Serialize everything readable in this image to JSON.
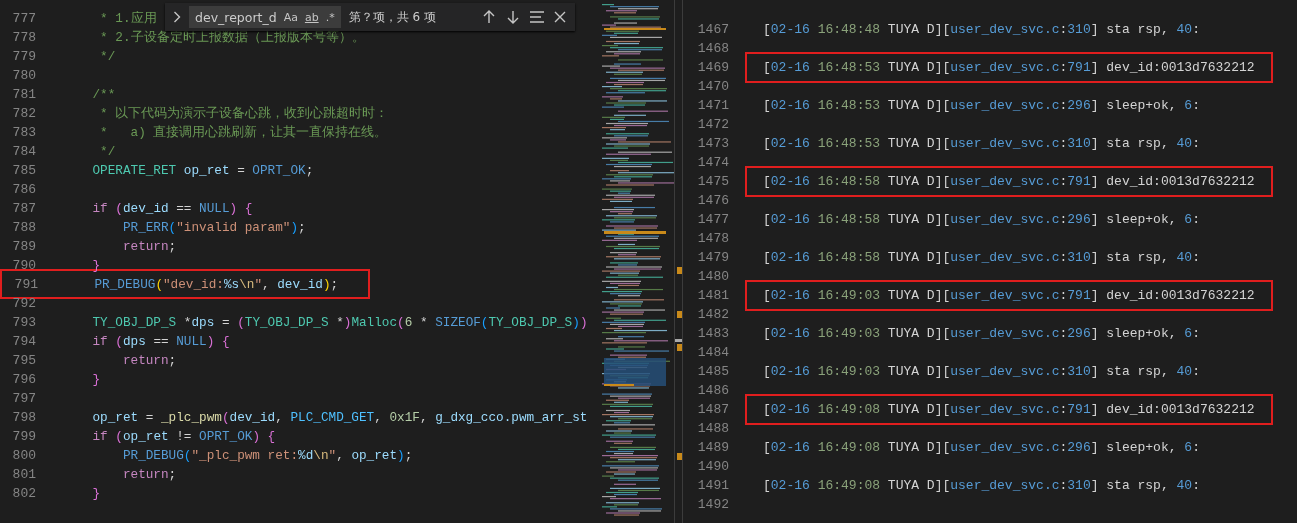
{
  "find_widget": {
    "value": "dev_report_d",
    "options": [
      {
        "text": "Aa",
        "kind": "case"
      },
      {
        "text": "ab",
        "kind": "word"
      },
      {
        "text": ".*",
        "kind": "regex"
      }
    ],
    "result": "第？项，共 6 项"
  },
  "editor": {
    "lines": [
      {
        "number": "777",
        "tokens": [
          {
            "kind": "c",
            "text": "     * 1.应用"
          }
        ]
      },
      {
        "number": "778",
        "tokens": [
          {
            "kind": "c",
            "text": "     * 2.子设备定时上报数据（上报版本号等）。"
          }
        ]
      },
      {
        "number": "779",
        "tokens": [
          {
            "kind": "c",
            "text": "     */"
          }
        ]
      },
      {
        "number": "780"
      },
      {
        "number": "781",
        "tokens": [
          {
            "kind": "c",
            "text": "    /**"
          }
        ]
      },
      {
        "number": "782",
        "tokens": [
          {
            "kind": "c",
            "text": "     * 以下代码为演示子设备心跳，收到心跳超时时："
          }
        ]
      },
      {
        "number": "783",
        "tokens": [
          {
            "kind": "c",
            "text": "     *   a) 直接调用心跳刷新，让其一直保持在线。"
          }
        ]
      },
      {
        "number": "784",
        "tokens": [
          {
            "kind": "c",
            "text": "     */"
          }
        ]
      },
      {
        "number": "785",
        "tokens": [
          {
            "kind": "t",
            "text": "    OPERATE_RET"
          },
          {
            "kind": "v",
            "text": " op_ret"
          },
          {
            "kind": "p",
            "text": " = "
          },
          {
            "kind": "b",
            "text": "OPRT_OK"
          },
          {
            "kind": "p",
            "text": ";"
          }
        ]
      },
      {
        "number": "786"
      },
      {
        "number": "787",
        "tokens": [
          {
            "kind": "k",
            "text": "    if "
          },
          {
            "kind": "z",
            "text": "("
          },
          {
            "kind": "v",
            "text": "dev_id"
          },
          {
            "kind": "p",
            "text": " == "
          },
          {
            "kind": "b",
            "text": "NULL"
          },
          {
            "kind": "z",
            "text": ") {"
          }
        ]
      },
      {
        "number": "788",
        "tokens": [
          {
            "kind": "b",
            "text": "        PR_ERR"
          },
          {
            "kind": "q",
            "text": "("
          },
          {
            "kind": "s",
            "text": "\"invalid param\""
          },
          {
            "kind": "q",
            "text": ")"
          },
          {
            "kind": "p",
            "text": ";"
          }
        ]
      },
      {
        "number": "789",
        "tokens": [
          {
            "kind": "k",
            "text": "        return"
          },
          {
            "kind": "p",
            "text": ";"
          }
        ]
      },
      {
        "number": "790",
        "tokens": [
          {
            "kind": "z",
            "text": "    }"
          }
        ]
      },
      {
        "number": "791",
        "highlighted": true,
        "tokens": [
          {
            "kind": "b",
            "text": "    PR_DEBUG"
          },
          {
            "kind": "y",
            "text": "("
          },
          {
            "kind": "s",
            "text": "\"dev_id:"
          },
          {
            "kind": "v",
            "text": "%s"
          },
          {
            "kind": "e",
            "text": "\\n"
          },
          {
            "kind": "s",
            "text": "\""
          },
          {
            "kind": "p",
            "text": ", "
          },
          {
            "kind": "v",
            "text": "dev_id"
          },
          {
            "kind": "y",
            "text": ")"
          },
          {
            "kind": "p",
            "text": ";"
          }
        ]
      },
      {
        "number": "792"
      },
      {
        "number": "793",
        "tokens": [
          {
            "kind": "t",
            "text": "    TY_OBJ_DP_S"
          },
          {
            "kind": "p",
            "text": " *"
          },
          {
            "kind": "v",
            "text": "dps"
          },
          {
            "kind": "p",
            "text": " = "
          },
          {
            "kind": "z",
            "text": "("
          },
          {
            "kind": "t",
            "text": "TY_OBJ_DP_S"
          },
          {
            "kind": "p",
            "text": " *"
          },
          {
            "kind": "z",
            "text": ")"
          },
          {
            "kind": "t",
            "text": "Malloc"
          },
          {
            "kind": "z",
            "text": "("
          },
          {
            "kind": "n",
            "text": "6"
          },
          {
            "kind": "p",
            "text": " * "
          },
          {
            "kind": "b",
            "text": "SIZEOF"
          },
          {
            "kind": "q",
            "text": "("
          },
          {
            "kind": "t",
            "text": "TY_OBJ_DP_S"
          },
          {
            "kind": "q",
            "text": ")"
          },
          {
            "kind": "z",
            "text": ")"
          }
        ]
      },
      {
        "number": "794",
        "tokens": [
          {
            "kind": "k",
            "text": "    if "
          },
          {
            "kind": "z",
            "text": "("
          },
          {
            "kind": "v",
            "text": "dps"
          },
          {
            "kind": "p",
            "text": " == "
          },
          {
            "kind": "b",
            "text": "NULL"
          },
          {
            "kind": "z",
            "text": ") {"
          }
        ]
      },
      {
        "number": "795",
        "tokens": [
          {
            "kind": "k",
            "text": "        return"
          },
          {
            "kind": "p",
            "text": ";"
          }
        ]
      },
      {
        "number": "796",
        "tokens": [
          {
            "kind": "z",
            "text": "    }"
          }
        ]
      },
      {
        "number": "797"
      },
      {
        "number": "798",
        "tokens": [
          {
            "kind": "v",
            "text": "    op_ret"
          },
          {
            "kind": "p",
            "text": " = "
          },
          {
            "kind": "f",
            "text": "_plc_pwm"
          },
          {
            "kind": "z",
            "text": "("
          },
          {
            "kind": "v",
            "text": "dev_id"
          },
          {
            "kind": "p",
            "text": ", "
          },
          {
            "kind": "m",
            "text": "PLC_CMD_GET"
          },
          {
            "kind": "p",
            "text": ", "
          },
          {
            "kind": "n",
            "text": "0x1F"
          },
          {
            "kind": "p",
            "text": ", "
          },
          {
            "kind": "v",
            "text": "g_dxg_cco.pwm_arr_st"
          }
        ]
      },
      {
        "number": "799",
        "tokens": [
          {
            "kind": "k",
            "text": "    if "
          },
          {
            "kind": "z",
            "text": "("
          },
          {
            "kind": "v",
            "text": "op_ret"
          },
          {
            "kind": "p",
            "text": " != "
          },
          {
            "kind": "b",
            "text": "OPRT_OK"
          },
          {
            "kind": "z",
            "text": ") {"
          }
        ]
      },
      {
        "number": "800",
        "tokens": [
          {
            "kind": "b",
            "text": "        PR_DEBUG"
          },
          {
            "kind": "q",
            "text": "("
          },
          {
            "kind": "s",
            "text": "\"_plc_pwm ret:"
          },
          {
            "kind": "v",
            "text": "%d"
          },
          {
            "kind": "e",
            "text": "\\n"
          },
          {
            "kind": "s",
            "text": "\""
          },
          {
            "kind": "p",
            "text": ", "
          },
          {
            "kind": "v",
            "text": "op_ret"
          },
          {
            "kind": "q",
            "text": ")"
          },
          {
            "kind": "p",
            "text": ";"
          }
        ]
      },
      {
        "number": "801",
        "tokens": [
          {
            "kind": "k",
            "text": "        return"
          },
          {
            "kind": "p",
            "text": ";"
          }
        ]
      },
      {
        "number": "802",
        "tokens": [
          {
            "kind": "z",
            "text": "    }"
          }
        ]
      }
    ]
  },
  "log": {
    "lines": [
      {
        "number": "1467",
        "tokens": [
          {
            "kind": "p",
            "text": "["
          },
          {
            "kind": "b",
            "text": "02-16"
          },
          {
            "kind": "g",
            "text": " 16:48:48"
          },
          {
            "kind": "p",
            "text": " TUYA D]["
          },
          {
            "kind": "b",
            "text": "user_dev_svc.c"
          },
          {
            "kind": "p",
            "text": ":"
          },
          {
            "kind": "b",
            "text": "310"
          },
          {
            "kind": "p",
            "text": "] sta rsp, "
          },
          {
            "kind": "b",
            "text": "40"
          },
          {
            "kind": "p",
            "text": ":"
          }
        ]
      },
      {
        "number": "1468"
      },
      {
        "number": "1469",
        "highlighted": true,
        "tokens": [
          {
            "kind": "p",
            "text": "["
          },
          {
            "kind": "b",
            "text": "02-16"
          },
          {
            "kind": "g",
            "text": " 16:48:53"
          },
          {
            "kind": "p",
            "text": " TUYA D]["
          },
          {
            "kind": "b",
            "text": "user_dev_svc.c"
          },
          {
            "kind": "p",
            "text": ":"
          },
          {
            "kind": "b",
            "text": "791"
          },
          {
            "kind": "p",
            "text": "] dev_id:0013d7632212"
          }
        ]
      },
      {
        "number": "1470"
      },
      {
        "number": "1471",
        "tokens": [
          {
            "kind": "p",
            "text": "["
          },
          {
            "kind": "b",
            "text": "02-16"
          },
          {
            "kind": "g",
            "text": " 16:48:53"
          },
          {
            "kind": "p",
            "text": " TUYA D]["
          },
          {
            "kind": "b",
            "text": "user_dev_svc.c"
          },
          {
            "kind": "p",
            "text": ":"
          },
          {
            "kind": "b",
            "text": "296"
          },
          {
            "kind": "p",
            "text": "] sleep+ok, "
          },
          {
            "kind": "b",
            "text": "6"
          },
          {
            "kind": "p",
            "text": ":"
          }
        ]
      },
      {
        "number": "1472"
      },
      {
        "number": "1473",
        "tokens": [
          {
            "kind": "p",
            "text": "["
          },
          {
            "kind": "b",
            "text": "02-16"
          },
          {
            "kind": "g",
            "text": " 16:48:53"
          },
          {
            "kind": "p",
            "text": " TUYA D]["
          },
          {
            "kind": "b",
            "text": "user_dev_svc.c"
          },
          {
            "kind": "p",
            "text": ":"
          },
          {
            "kind": "b",
            "text": "310"
          },
          {
            "kind": "p",
            "text": "] sta rsp, "
          },
          {
            "kind": "b",
            "text": "40"
          },
          {
            "kind": "p",
            "text": ":"
          }
        ]
      },
      {
        "number": "1474"
      },
      {
        "number": "1475",
        "highlighted": true,
        "tokens": [
          {
            "kind": "p",
            "text": "["
          },
          {
            "kind": "b",
            "text": "02-16"
          },
          {
            "kind": "g",
            "text": " 16:48:58"
          },
          {
            "kind": "p",
            "text": " TUYA D]["
          },
          {
            "kind": "b",
            "text": "user_dev_svc.c"
          },
          {
            "kind": "p",
            "text": ":"
          },
          {
            "kind": "b",
            "text": "791"
          },
          {
            "kind": "p",
            "text": "] dev_id:0013d7632212"
          }
        ]
      },
      {
        "number": "1476"
      },
      {
        "number": "1477",
        "tokens": [
          {
            "kind": "p",
            "text": "["
          },
          {
            "kind": "b",
            "text": "02-16"
          },
          {
            "kind": "g",
            "text": " 16:48:58"
          },
          {
            "kind": "p",
            "text": " TUYA D]["
          },
          {
            "kind": "b",
            "text": "user_dev_svc.c"
          },
          {
            "kind": "p",
            "text": ":"
          },
          {
            "kind": "b",
            "text": "296"
          },
          {
            "kind": "p",
            "text": "] sleep+ok, "
          },
          {
            "kind": "b",
            "text": "6"
          },
          {
            "kind": "p",
            "text": ":"
          }
        ]
      },
      {
        "number": "1478"
      },
      {
        "number": "1479",
        "tokens": [
          {
            "kind": "p",
            "text": "["
          },
          {
            "kind": "b",
            "text": "02-16"
          },
          {
            "kind": "g",
            "text": " 16:48:58"
          },
          {
            "kind": "p",
            "text": " TUYA D]["
          },
          {
            "kind": "b",
            "text": "user_dev_svc.c"
          },
          {
            "kind": "p",
            "text": ":"
          },
          {
            "kind": "b",
            "text": "310"
          },
          {
            "kind": "p",
            "text": "] sta rsp, "
          },
          {
            "kind": "b",
            "text": "40"
          },
          {
            "kind": "p",
            "text": ":"
          }
        ]
      },
      {
        "number": "1480"
      },
      {
        "number": "1481",
        "highlighted": true,
        "tokens": [
          {
            "kind": "p",
            "text": "["
          },
          {
            "kind": "b",
            "text": "02-16"
          },
          {
            "kind": "g",
            "text": " 16:49:03"
          },
          {
            "kind": "p",
            "text": " TUYA D]["
          },
          {
            "kind": "b",
            "text": "user_dev_svc.c"
          },
          {
            "kind": "p",
            "text": ":"
          },
          {
            "kind": "b",
            "text": "791"
          },
          {
            "kind": "p",
            "text": "] dev_id:0013d7632212"
          }
        ]
      },
      {
        "number": "1482"
      },
      {
        "number": "1483",
        "tokens": [
          {
            "kind": "p",
            "text": "["
          },
          {
            "kind": "b",
            "text": "02-16"
          },
          {
            "kind": "g",
            "text": " 16:49:03"
          },
          {
            "kind": "p",
            "text": " TUYA D]["
          },
          {
            "kind": "b",
            "text": "user_dev_svc.c"
          },
          {
            "kind": "p",
            "text": ":"
          },
          {
            "kind": "b",
            "text": "296"
          },
          {
            "kind": "p",
            "text": "] sleep+ok, "
          },
          {
            "kind": "b",
            "text": "6"
          },
          {
            "kind": "p",
            "text": ":"
          }
        ]
      },
      {
        "number": "1484"
      },
      {
        "number": "1485",
        "tokens": [
          {
            "kind": "p",
            "text": "["
          },
          {
            "kind": "b",
            "text": "02-16"
          },
          {
            "kind": "g",
            "text": " 16:49:03"
          },
          {
            "kind": "p",
            "text": " TUYA D]["
          },
          {
            "kind": "b",
            "text": "user_dev_svc.c"
          },
          {
            "kind": "p",
            "text": ":"
          },
          {
            "kind": "b",
            "text": "310"
          },
          {
            "kind": "p",
            "text": "] sta rsp, "
          },
          {
            "kind": "b",
            "text": "40"
          },
          {
            "kind": "p",
            "text": ":"
          }
        ]
      },
      {
        "number": "1486"
      },
      {
        "number": "1487",
        "highlighted": true,
        "tokens": [
          {
            "kind": "p",
            "text": "["
          },
          {
            "kind": "b",
            "text": "02-16"
          },
          {
            "kind": "g",
            "text": " 16:49:08"
          },
          {
            "kind": "p",
            "text": " TUYA D]["
          },
          {
            "kind": "b",
            "text": "user_dev_svc.c"
          },
          {
            "kind": "p",
            "text": ":"
          },
          {
            "kind": "b",
            "text": "791"
          },
          {
            "kind": "p",
            "text": "] dev_id:0013d7632212"
          }
        ]
      },
      {
        "number": "1488"
      },
      {
        "number": "1489",
        "tokens": [
          {
            "kind": "p",
            "text": "["
          },
          {
            "kind": "b",
            "text": "02-16"
          },
          {
            "kind": "g",
            "text": " 16:49:08"
          },
          {
            "kind": "p",
            "text": " TUYA D]["
          },
          {
            "kind": "b",
            "text": "user_dev_svc.c"
          },
          {
            "kind": "p",
            "text": ":"
          },
          {
            "kind": "b",
            "text": "296"
          },
          {
            "kind": "p",
            "text": "] sleep+ok, "
          },
          {
            "kind": "b",
            "text": "6"
          },
          {
            "kind": "p",
            "text": ":"
          }
        ]
      },
      {
        "number": "1490"
      },
      {
        "number": "1491",
        "tokens": [
          {
            "kind": "p",
            "text": "["
          },
          {
            "kind": "b",
            "text": "02-16"
          },
          {
            "kind": "g",
            "text": " 16:49:08"
          },
          {
            "kind": "p",
            "text": " TUYA D]["
          },
          {
            "kind": "b",
            "text": "user_dev_svc.c"
          },
          {
            "kind": "p",
            "text": ":"
          },
          {
            "kind": "b",
            "text": "310"
          },
          {
            "kind": "p",
            "text": "] sta rsp, "
          },
          {
            "kind": "b",
            "text": "40"
          },
          {
            "kind": "p",
            "text": ":"
          }
        ]
      },
      {
        "number": "1492"
      }
    ]
  }
}
